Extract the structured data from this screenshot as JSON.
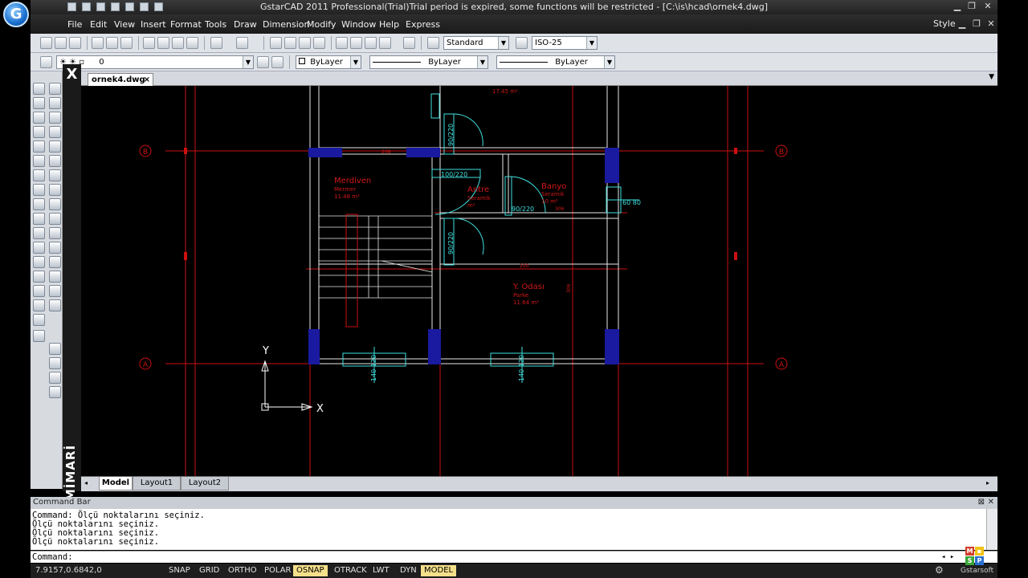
{
  "title_bar": {
    "title": "GstarCAD 2011 Professional(Trial)Trial period is expired, some functions will be restricted - [C:\\is\\hcad\\ornek4.dwg]",
    "minimize": "▁",
    "restore": "❐",
    "close": "✕"
  },
  "app_logo": "G",
  "menu": {
    "items": [
      "File",
      "Edit",
      "View",
      "Insert",
      "Format",
      "Tools",
      "Draw",
      "Dimension",
      "Modify",
      "Window",
      "Help",
      "Express"
    ],
    "style_label": "Style"
  },
  "toolbar": {
    "text_style": "Standard",
    "dim_style": "ISO-25",
    "layer": "0",
    "color": "ByLayer",
    "linetype": "ByLayer",
    "lineweight": "ByLayer"
  },
  "banner": {
    "close": "X",
    "text": "HCAD MİMARİ"
  },
  "document": {
    "tab": "ornek4.dwg",
    "tab_close": "×"
  },
  "drawing": {
    "axis_markers": [
      "B",
      "B",
      "A",
      "A"
    ],
    "rooms": [
      {
        "name": "Merdiven",
        "sub": "Mermer",
        "area": "11.48 m²"
      },
      {
        "name": "Antre",
        "sub": "Seramik",
        "area": "m²"
      },
      {
        "name": "Banyo",
        "sub": "Seramik",
        "area": "10 m²"
      },
      {
        "name": "Y. Odası",
        "sub": "Parke",
        "area": "11.64 m²"
      }
    ],
    "top_area": "17.45 m²",
    "doors": [
      "90/220",
      "100/220",
      "90/220",
      "90/220"
    ],
    "windows": [
      "140\n120",
      "140\n120",
      "60\n80"
    ],
    "dim_small": [
      "208",
      "306",
      "200",
      "306"
    ],
    "ucs_x": "X",
    "ucs_y": "Y"
  },
  "layout_tabs": [
    "Model",
    "Layout1",
    "Layout2"
  ],
  "command": {
    "header": "Command Bar",
    "history": [
      "Command: Ölçü noktalarını seçiniz.",
      "Ölçü noktalarını seçiniz.",
      "Ölçü noktalarını seçiniz.",
      "Ölçü noktalarını seçiniz."
    ],
    "prompt": "Command:"
  },
  "status": {
    "coords": "7.9157,0.6842,0",
    "toggles": [
      {
        "label": "SNAP",
        "on": false
      },
      {
        "label": "GRID",
        "on": false
      },
      {
        "label": "ORTHO",
        "on": false
      },
      {
        "label": "POLAR",
        "on": false
      },
      {
        "label": "OSNAP",
        "on": true
      },
      {
        "label": "OTRACK",
        "on": false
      },
      {
        "label": "LWT",
        "on": false
      },
      {
        "label": "DYN",
        "on": false
      },
      {
        "label": "MODEL",
        "on": true
      }
    ],
    "vendor": "Gstarsoft"
  },
  "colors": {
    "axis_red": "#cc1010",
    "wall_white": "#e8e8e8",
    "door_cyan": "#40e0e0",
    "column_blue": "#1a1aa0",
    "text_red": "#d01818",
    "accent_yellow": "#f5e08a"
  }
}
